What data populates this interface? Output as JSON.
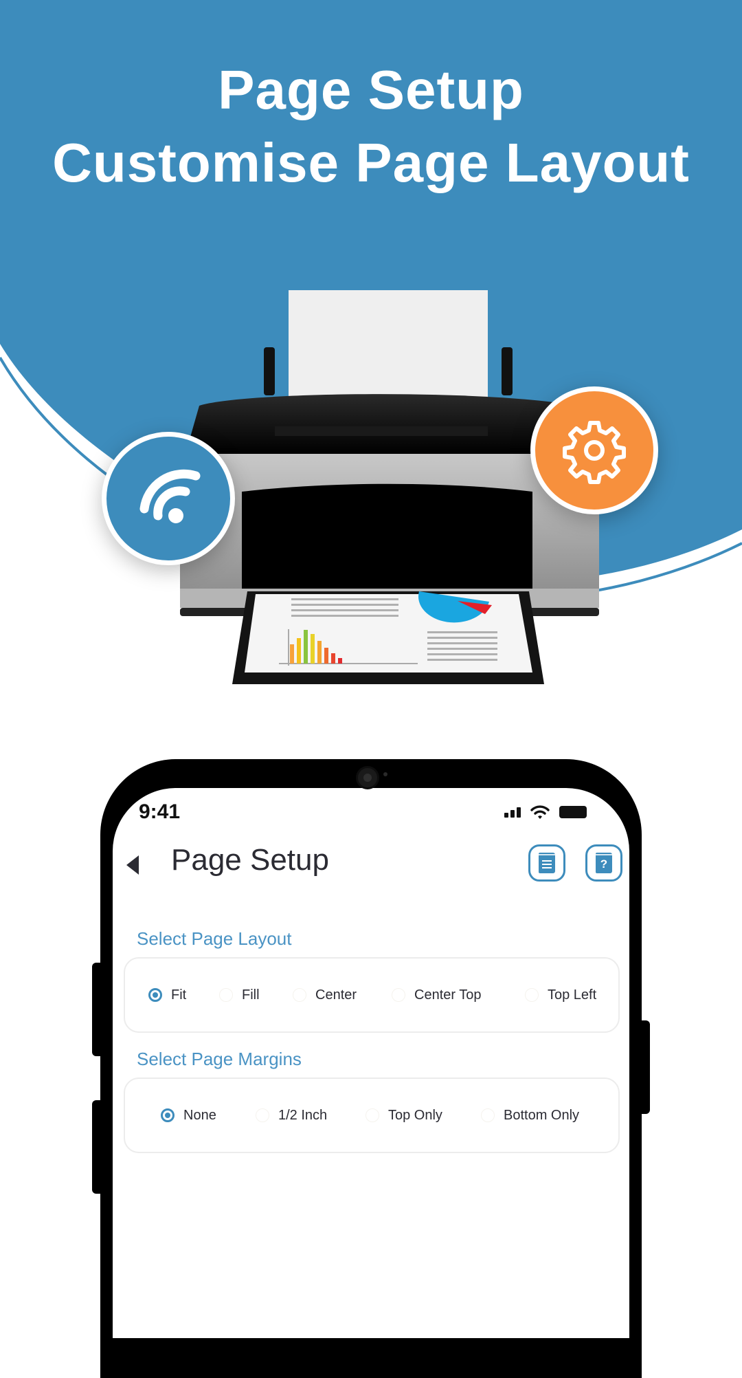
{
  "headline": {
    "line1": "Page Setup",
    "line2": "Customise Page Layout"
  },
  "colors": {
    "brand_blue": "#3d8cbc",
    "accent_orange": "#f7903d",
    "title_text": "#2b2b33",
    "section_label": "#4a93c4"
  },
  "illustration": {
    "subject": "printer-icon",
    "badges": [
      "wifi-icon",
      "gear-icon"
    ]
  },
  "status_bar": {
    "time": "9:41",
    "icons": [
      "signal-icon",
      "wifi-icon",
      "battery-icon"
    ]
  },
  "app_bar": {
    "back_icon": "back-icon",
    "title": "Page Setup",
    "actions": [
      {
        "icon": "book-list-icon"
      },
      {
        "icon": "book-help-icon",
        "glyph": "?"
      }
    ]
  },
  "layout_section": {
    "label": "Select Page Layout",
    "selected": "Fit",
    "options": [
      "Fit",
      "Fill",
      "Center",
      "Center Top",
      "Top Left"
    ]
  },
  "margins_section": {
    "label": "Select Page Margins",
    "selected": "None",
    "options": [
      "None",
      "1/2 Inch",
      "Top Only",
      "Bottom Only"
    ]
  }
}
